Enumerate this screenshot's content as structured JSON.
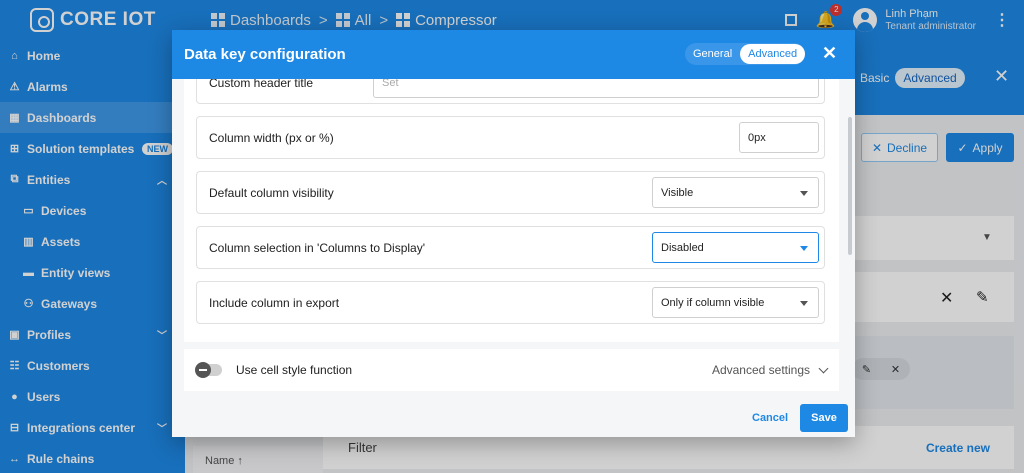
{
  "app": {
    "logo_text": "CORE IOT"
  },
  "breadcrumb": [
    {
      "label": "Dashboards",
      "separator": ">"
    },
    {
      "label": "All",
      "separator": ">"
    },
    {
      "label": "Compressor"
    }
  ],
  "top_right": {
    "notification_count": "2",
    "user_name": "Linh Phạm",
    "user_role": "Tenant administrator"
  },
  "sidebar": {
    "items": [
      {
        "label": "Home",
        "icon": "home-icon",
        "glyph": "⌂"
      },
      {
        "label": "Alarms",
        "icon": "warning-icon",
        "glyph": "⚠"
      },
      {
        "label": "Dashboards",
        "icon": "dashboard-icon",
        "glyph": "▦"
      },
      {
        "label": "Solution templates",
        "icon": "apps-icon",
        "glyph": "⊞",
        "badge": "NEW"
      },
      {
        "label": "Entities",
        "icon": "entities-icon",
        "glyph": "⧉",
        "expanded": true
      },
      {
        "label": "Devices",
        "icon": "devices-icon",
        "glyph": "▭",
        "sub": true
      },
      {
        "label": "Assets",
        "icon": "assets-icon",
        "glyph": "▥",
        "sub": true
      },
      {
        "label": "Entity views",
        "icon": "entity-views-icon",
        "glyph": "▬",
        "sub": true
      },
      {
        "label": "Gateways",
        "icon": "gateways-icon",
        "glyph": "⚇",
        "sub": true
      },
      {
        "label": "Profiles",
        "icon": "profiles-icon",
        "glyph": "▣",
        "collapsed": true
      },
      {
        "label": "Customers",
        "icon": "customers-icon",
        "glyph": "☷"
      },
      {
        "label": "Users",
        "icon": "users-icon",
        "glyph": "●"
      },
      {
        "label": "Integrations center",
        "icon": "integrations-icon",
        "glyph": "⊟",
        "collapsed": true
      },
      {
        "label": "Rule chains",
        "icon": "rule-chains-icon",
        "glyph": "↔"
      }
    ]
  },
  "background": {
    "mode_toggle": {
      "basic": "Basic",
      "advanced": "Advanced"
    },
    "decline_label": "Decline",
    "apply_label": "Apply",
    "filter_label": "Filter",
    "create_new_label": "Create new",
    "name_column_label": "Name ↑"
  },
  "dialog": {
    "title": "Data key configuration",
    "tabs": {
      "general": "General",
      "advanced": "Advanced",
      "selected": "Advanced"
    },
    "partial_row": {
      "label": "Custom header title",
      "placeholder": "Set"
    },
    "rows": [
      {
        "label": "Column width (px or %)",
        "value": "0px",
        "type": "input"
      },
      {
        "label": "Default column visibility",
        "value": "Visible",
        "type": "select"
      },
      {
        "label": "Column selection in 'Columns to Display'",
        "value": "Disabled",
        "type": "select",
        "focused": true
      },
      {
        "label": "Include column in export",
        "value": "Only if column visible",
        "type": "select"
      }
    ],
    "cell_style": {
      "label": "Use cell style function",
      "enabled": false,
      "advanced_label": "Advanced settings"
    },
    "actions": {
      "cancel": "Cancel",
      "save": "Save"
    }
  },
  "colors": {
    "primary": "#1e88e5",
    "sidebar": "#1e88e5",
    "badge": "#e53935"
  }
}
